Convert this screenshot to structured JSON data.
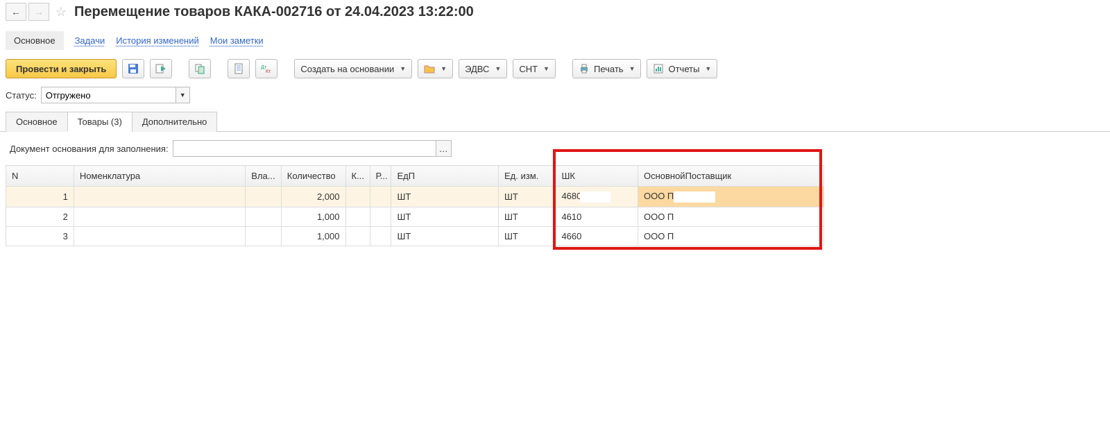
{
  "header": {
    "title": "Перемещение товаров КАКА-002716 от 24.04.2023 13:22:00"
  },
  "nav": {
    "main": "Основное",
    "tasks": "Задачи",
    "history": "История изменений",
    "notes": "Мои заметки"
  },
  "toolbar": {
    "post_close": "Провести и закрыть",
    "create_based": "Создать на основании",
    "edvs": "ЭДВС",
    "snt": "СНТ",
    "print": "Печать",
    "reports": "Отчеты"
  },
  "status": {
    "label": "Статус:",
    "value": "Отгружено"
  },
  "subtabs": {
    "main": "Основное",
    "goods": "Товары (3)",
    "extra": "Дополнительно"
  },
  "basis": {
    "label": "Документ основания для заполнения:",
    "value": ""
  },
  "table": {
    "columns": {
      "n": "N",
      "nom": "Номенклатура",
      "vla": "Вла...",
      "qty": "Количество",
      "k": "К...",
      "r": "Р...",
      "edp": "ЕдП",
      "ei": "Ед. изм.",
      "shk": "ШК",
      "sup": "ОсновнойПоставщик"
    },
    "rows": [
      {
        "n": "1",
        "qty": "2,000",
        "edp": "ШТ",
        "ei": "ШТ",
        "shk": "4680",
        "sup": "ООО П"
      },
      {
        "n": "2",
        "qty": "1,000",
        "edp": "ШТ",
        "ei": "ШТ",
        "shk": "4610",
        "sup": "ООО П"
      },
      {
        "n": "3",
        "qty": "1,000",
        "edp": "ШТ",
        "ei": "ШТ",
        "shk": "4660",
        "sup": "ООО П"
      }
    ]
  }
}
